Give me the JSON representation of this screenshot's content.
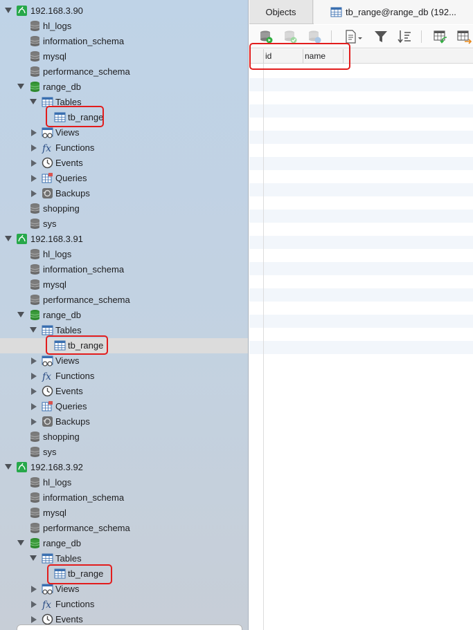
{
  "sidebar": {
    "connections": [
      {
        "host": "192.168.3.90",
        "databases": [
          "hl_logs",
          "information_schema",
          "mysql",
          "performance_schema",
          "range_db",
          "shopping",
          "sys"
        ],
        "open_db": "range_db",
        "sections": {
          "tables": "Tables",
          "views": "Views",
          "functions": "Functions",
          "events": "Events",
          "queries": "Queries",
          "backups": "Backups"
        },
        "table": "tb_range"
      },
      {
        "host": "192.168.3.91",
        "databases": [
          "hl_logs",
          "information_schema",
          "mysql",
          "performance_schema",
          "range_db",
          "shopping",
          "sys"
        ],
        "open_db": "range_db",
        "sections": {
          "tables": "Tables",
          "views": "Views",
          "functions": "Functions",
          "events": "Events",
          "queries": "Queries",
          "backups": "Backups"
        },
        "table": "tb_range"
      },
      {
        "host": "192.168.3.92",
        "databases": [
          "hl_logs",
          "information_schema",
          "mysql",
          "performance_schema",
          "range_db"
        ],
        "open_db": "range_db",
        "sections": {
          "tables": "Tables",
          "views": "Views",
          "functions": "Functions",
          "events": "Events"
        },
        "table": "tb_range"
      }
    ]
  },
  "tabs": {
    "objects": "Objects",
    "table": "tb_range@range_db (192..."
  },
  "grid": {
    "columns": [
      "id",
      "name"
    ]
  },
  "icons": {
    "connection": "mysql-connection-icon",
    "database": "database-icon",
    "open_database": "database-open-icon",
    "tables": "tables-icon",
    "table": "table-icon",
    "views": "views-icon",
    "functions": "function-icon",
    "events": "events-clock-icon",
    "queries": "queries-icon",
    "backups": "backups-icon"
  },
  "colors": {
    "highlight": "#e21c1c",
    "db_green": "#3a9a3a",
    "connection_green": "#27a84a",
    "selection": "#dcdcdc"
  }
}
